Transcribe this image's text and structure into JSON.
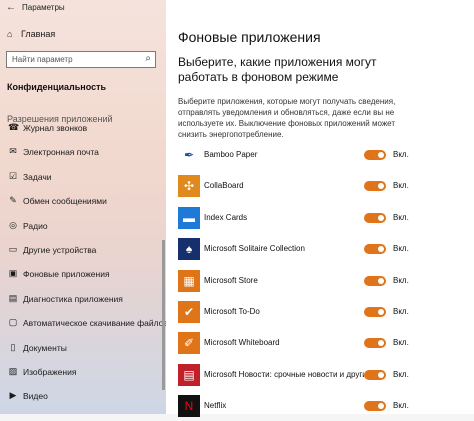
{
  "window": {
    "title": "Параметры",
    "back": "←",
    "minimize": "—",
    "maximize": "☐",
    "close": "✕"
  },
  "sidebar": {
    "home": "Главная",
    "search_placeholder": "Найти параметр",
    "section": "Конфиденциальность",
    "group": "Разрешения приложений",
    "items": [
      {
        "label": "Журнал звонков",
        "icon": "call-log-icon",
        "glyph": "☎"
      },
      {
        "label": "Электронная почта",
        "icon": "mail-icon",
        "glyph": "✉"
      },
      {
        "label": "Задачи",
        "icon": "tasks-icon",
        "glyph": "☑"
      },
      {
        "label": "Обмен сообщениями",
        "icon": "messaging-icon",
        "glyph": "✎"
      },
      {
        "label": "Радио",
        "icon": "radio-icon",
        "glyph": "◎"
      },
      {
        "label": "Другие устройства",
        "icon": "devices-icon",
        "glyph": "▭"
      },
      {
        "label": "Фоновые приложения",
        "icon": "background-apps-icon",
        "glyph": "▣"
      },
      {
        "label": "Диагностика приложения",
        "icon": "diagnostics-icon",
        "glyph": "▤"
      },
      {
        "label": "Автоматическое скачивание файлов",
        "icon": "download-icon",
        "glyph": "▢"
      },
      {
        "label": "Документы",
        "icon": "documents-icon",
        "glyph": "▯"
      },
      {
        "label": "Изображения",
        "icon": "images-icon",
        "glyph": "▨"
      },
      {
        "label": "Видео",
        "icon": "video-icon",
        "glyph": "▶"
      }
    ]
  },
  "main": {
    "title": "Фоновые приложения",
    "subtitle": "Выберите, какие приложения могут работать в фоновом режиме",
    "description": "Выберите приложения, которые могут получать сведения, отправлять уведомления и обновляться, даже если вы не используете их. Выключение фоновых приложений может снизить энергопотребление.",
    "apps": [
      {
        "name": "Bamboo Paper",
        "state": "Вкл.",
        "color": "#ffffff",
        "glyph": "✒",
        "fg": "#1a4fa0"
      },
      {
        "name": "CollaBoard",
        "state": "Вкл.",
        "color": "#e08a1e",
        "glyph": "✣",
        "fg": "#ffffff"
      },
      {
        "name": "Index Cards",
        "state": "Вкл.",
        "color": "#1e7ad6",
        "glyph": "▬",
        "fg": "#ffffff"
      },
      {
        "name": "Microsoft Solitaire Collection",
        "state": "Вкл.",
        "color": "#16306e",
        "glyph": "♠",
        "fg": "#ffffff"
      },
      {
        "name": "Microsoft Store",
        "state": "Вкл.",
        "color": "#e07418",
        "glyph": "▦",
        "fg": "#ffffff"
      },
      {
        "name": "Microsoft To-Do",
        "state": "Вкл.",
        "color": "#e07418",
        "glyph": "✔",
        "fg": "#ffffff"
      },
      {
        "name": "Microsoft Whiteboard",
        "state": "Вкл.",
        "color": "#e07418",
        "glyph": "✐",
        "fg": "#ffffff"
      },
      {
        "name": "Microsoft Новости: срочные новости и другие",
        "state": "Вкл.",
        "color": "#c0202a",
        "glyph": "▤",
        "fg": "#ffffff"
      },
      {
        "name": "Netflix",
        "state": "Вкл.",
        "color": "#111111",
        "glyph": "N",
        "fg": "#e50914"
      }
    ],
    "accent": "#e07418"
  }
}
